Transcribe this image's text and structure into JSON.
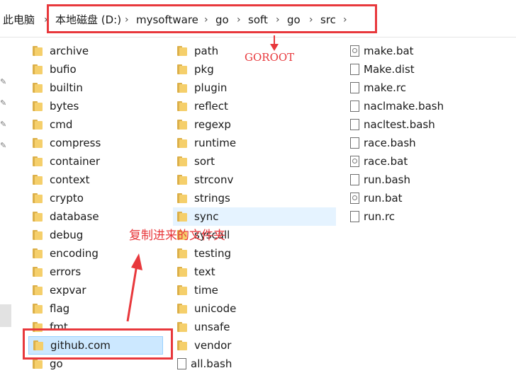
{
  "address": {
    "root": "此电脑",
    "segments": [
      "本地磁盘 (D:)",
      "mysoftware",
      "go",
      "soft",
      "go",
      "src"
    ]
  },
  "columns": {
    "col1": [
      "archive",
      "bufio",
      "builtin",
      "bytes",
      "cmd",
      "compress",
      "container",
      "context",
      "crypto",
      "database",
      "debug",
      "encoding",
      "errors",
      "expvar",
      "flag",
      "fmt",
      "github.com",
      "go"
    ],
    "col2": [
      "path",
      "pkg",
      "plugin",
      "reflect",
      "regexp",
      "runtime",
      "sort",
      "strconv",
      "strings",
      "sync",
      "syscall",
      "testing",
      "text",
      "time",
      "unicode",
      "unsafe",
      "vendor",
      "all.bash"
    ],
    "col3": [
      "make.bat",
      "Make.dist",
      "make.rc",
      "naclmake.bash",
      "nacltest.bash",
      "race.bash",
      "race.bat",
      "run.bash",
      "run.bat",
      "run.rc"
    ]
  },
  "annotations": {
    "goroot": "GOROOT",
    "copied": "复制进来的文件夹"
  },
  "colors": {
    "annotation_red": "#e8383c",
    "selected_bg": "#cce8ff",
    "hover_bg": "#e5f3ff"
  }
}
